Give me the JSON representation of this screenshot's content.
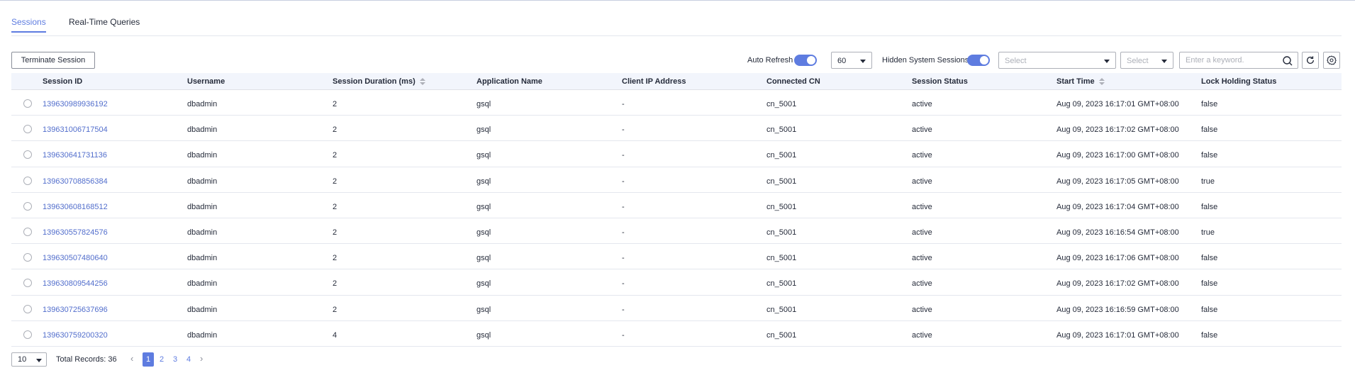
{
  "tabs": [
    {
      "label": "Sessions",
      "active": true
    },
    {
      "label": "Real-Time Queries",
      "active": false
    }
  ],
  "toolbar": {
    "terminate_label": "Terminate Session",
    "auto_refresh_label": "Auto Refresh",
    "auto_refresh_on": true,
    "interval_value": "60",
    "hidden_system_label": "Hidden System Sessions",
    "hidden_system_on": true,
    "filter1_placeholder": "Select",
    "filter2_placeholder": "Select",
    "search_placeholder": "Enter a keyword.",
    "icons": [
      "search-icon",
      "refresh-icon",
      "settings-icon"
    ]
  },
  "table": {
    "columns": [
      {
        "label": "Session ID",
        "sortable": false
      },
      {
        "label": "Username",
        "sortable": false
      },
      {
        "label": "Session Duration (ms)",
        "sortable": true
      },
      {
        "label": "Application Name",
        "sortable": false
      },
      {
        "label": "Client IP Address",
        "sortable": false
      },
      {
        "label": "Connected CN",
        "sortable": false
      },
      {
        "label": "Session Status",
        "sortable": false
      },
      {
        "label": "Start Time",
        "sortable": true
      },
      {
        "label": "Lock Holding Status",
        "sortable": false
      }
    ],
    "rows": [
      [
        "139630989936192",
        "dbadmin",
        "2",
        "gsql",
        "-",
        "cn_5001",
        "active",
        "Aug 09, 2023 16:17:01 GMT+08:00",
        "false"
      ],
      [
        "139631006717504",
        "dbadmin",
        "2",
        "gsql",
        "-",
        "cn_5001",
        "active",
        "Aug 09, 2023 16:17:02 GMT+08:00",
        "false"
      ],
      [
        "139630641731136",
        "dbadmin",
        "2",
        "gsql",
        "-",
        "cn_5001",
        "active",
        "Aug 09, 2023 16:17:00 GMT+08:00",
        "false"
      ],
      [
        "139630708856384",
        "dbadmin",
        "2",
        "gsql",
        "-",
        "cn_5001",
        "active",
        "Aug 09, 2023 16:17:05 GMT+08:00",
        "true"
      ],
      [
        "139630608168512",
        "dbadmin",
        "2",
        "gsql",
        "-",
        "cn_5001",
        "active",
        "Aug 09, 2023 16:17:04 GMT+08:00",
        "false"
      ],
      [
        "139630557824576",
        "dbadmin",
        "2",
        "gsql",
        "-",
        "cn_5001",
        "active",
        "Aug 09, 2023 16:16:54 GMT+08:00",
        "true"
      ],
      [
        "139630507480640",
        "dbadmin",
        "2",
        "gsql",
        "-",
        "cn_5001",
        "active",
        "Aug 09, 2023 16:17:06 GMT+08:00",
        "false"
      ],
      [
        "139630809544256",
        "dbadmin",
        "2",
        "gsql",
        "-",
        "cn_5001",
        "active",
        "Aug 09, 2023 16:17:02 GMT+08:00",
        "false"
      ],
      [
        "139630725637696",
        "dbadmin",
        "2",
        "gsql",
        "-",
        "cn_5001",
        "active",
        "Aug 09, 2023 16:16:59 GMT+08:00",
        "false"
      ],
      [
        "139630759200320",
        "dbadmin",
        "4",
        "gsql",
        "-",
        "cn_5001",
        "active",
        "Aug 09, 2023 16:17:01 GMT+08:00",
        "false"
      ]
    ]
  },
  "pagination": {
    "page_size": "10",
    "total_label": "Total Records: 36",
    "pages": [
      "1",
      "2",
      "3",
      "4"
    ],
    "current": "1"
  },
  "colors": {
    "accent": "#5e7ce0",
    "link": "#526ecc",
    "header_bg": "#f2f5fc"
  }
}
